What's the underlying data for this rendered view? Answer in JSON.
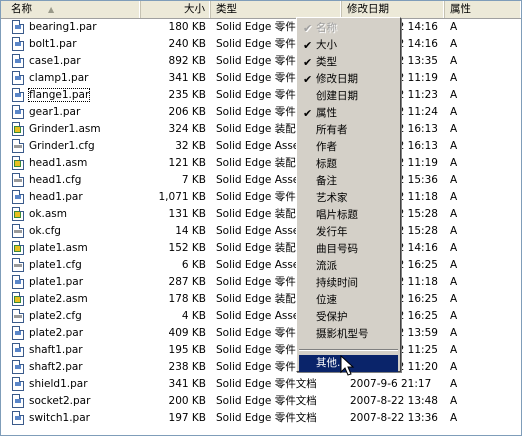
{
  "columns": {
    "name": "名称",
    "size": "大小",
    "type": "类型",
    "date": "修改日期",
    "attr": "属性"
  },
  "files": [
    {
      "name": "bearing1.par",
      "size": "180 KB",
      "type": "Solid Edge 零件文档",
      "date": "2007-8-22 14:16",
      "attr": "A",
      "icon": "par"
    },
    {
      "name": "bolt1.par",
      "size": "240 KB",
      "type": "Solid Edge 零件文档",
      "date": "2007-8-22 14:16",
      "attr": "A",
      "icon": "par"
    },
    {
      "name": "case1.par",
      "size": "892 KB",
      "type": "Solid Edge 零件文档",
      "date": "2007-8-22 13:35",
      "attr": "A",
      "icon": "par"
    },
    {
      "name": "clamp1.par",
      "size": "341 KB",
      "type": "Solid Edge 零件文档",
      "date": "2007-8-22 11:19",
      "attr": "A",
      "icon": "par"
    },
    {
      "name": "flange1.par",
      "size": "235 KB",
      "type": "Solid Edge 零件文档",
      "date": "2007-8-22 11:23",
      "attr": "A",
      "icon": "par"
    },
    {
      "name": "gear1.par",
      "size": "206 KB",
      "type": "Solid Edge 零件文档",
      "date": "2007-8-22 11:24",
      "attr": "A",
      "icon": "par"
    },
    {
      "name": "Grinder1.asm",
      "size": "324 KB",
      "type": "Solid Edge 装配文档",
      "date": "2007-8-22 16:13",
      "attr": "A",
      "icon": "asm"
    },
    {
      "name": "Grinder1.cfg",
      "size": "32 KB",
      "type": "Solid Edge Assembly",
      "date": "2007-8-22 16:13",
      "attr": "A",
      "icon": "cfg"
    },
    {
      "name": "head1.asm",
      "size": "121 KB",
      "type": "Solid Edge 装配文档",
      "date": "2007-8-22 11:19",
      "attr": "A",
      "icon": "asm"
    },
    {
      "name": "head1.cfg",
      "size": "7 KB",
      "type": "Solid Edge Assembly",
      "date": "2007-8-22 15:36",
      "attr": "A",
      "icon": "cfg"
    },
    {
      "name": "head1.par",
      "size": "1,071 KB",
      "type": "Solid Edge 零件文档",
      "date": "2007-8-22 11:18",
      "attr": "A",
      "icon": "par"
    },
    {
      "name": "ok.asm",
      "size": "131 KB",
      "type": "Solid Edge 装配文档",
      "date": "2007-8-22 15:28",
      "attr": "A",
      "icon": "asm"
    },
    {
      "name": "ok.cfg",
      "size": "14 KB",
      "type": "Solid Edge Assembly",
      "date": "2007-8-22 15:28",
      "attr": "A",
      "icon": "cfg"
    },
    {
      "name": "plate1.asm",
      "size": "152 KB",
      "type": "Solid Edge 装配文档",
      "date": "2007-8-22 14:16",
      "attr": "A",
      "icon": "asm"
    },
    {
      "name": "plate1.cfg",
      "size": "6 KB",
      "type": "Solid Edge Assembly",
      "date": "2007-8-22 16:25",
      "attr": "A",
      "icon": "cfg"
    },
    {
      "name": "plate1.par",
      "size": "287 KB",
      "type": "Solid Edge 零件文档",
      "date": "2007-8-22 11:18",
      "attr": "A",
      "icon": "par"
    },
    {
      "name": "plate2.asm",
      "size": "178 KB",
      "type": "Solid Edge 装配文档",
      "date": "2007-8-22 16:25",
      "attr": "A",
      "icon": "asm"
    },
    {
      "name": "plate2.cfg",
      "size": "4 KB",
      "type": "Solid Edge Assembly",
      "date": "2007-8-22 16:25",
      "attr": "A",
      "icon": "cfg"
    },
    {
      "name": "plate2.par",
      "size": "409 KB",
      "type": "Solid Edge 零件文档",
      "date": "2007-8-22 13:59",
      "attr": "A",
      "icon": "par"
    },
    {
      "name": "shaft1.par",
      "size": "195 KB",
      "type": "Solid Edge 零件文档",
      "date": "2007-8-22 11:25",
      "attr": "A",
      "icon": "par"
    },
    {
      "name": "shaft2.par",
      "size": "238 KB",
      "type": "Solid Edge 零件文档",
      "date": "2007-8-22 11:20",
      "attr": "A",
      "icon": "par"
    },
    {
      "name": "shield1.par",
      "size": "341 KB",
      "type": "Solid Edge 零件文档",
      "date": "2007-9-6 21:17",
      "attr": "A",
      "icon": "par"
    },
    {
      "name": "socket2.par",
      "size": "200 KB",
      "type": "Solid Edge 零件文档",
      "date": "2007-8-22 13:48",
      "attr": "A",
      "icon": "par"
    },
    {
      "name": "switch1.par",
      "size": "197 KB",
      "type": "Solid Edge 零件文档",
      "date": "2007-8-22 13:36",
      "attr": "A",
      "icon": "par"
    }
  ],
  "context_menu": [
    {
      "label": "名称",
      "checked": true,
      "disabled": true
    },
    {
      "label": "大小",
      "checked": true
    },
    {
      "label": "类型",
      "checked": true
    },
    {
      "label": "修改日期",
      "checked": true
    },
    {
      "label": "创建日期",
      "checked": false
    },
    {
      "label": "属性",
      "checked": true
    },
    {
      "label": "所有者",
      "checked": false
    },
    {
      "label": "作者",
      "checked": false
    },
    {
      "label": "标题",
      "checked": false
    },
    {
      "label": "备注",
      "checked": false
    },
    {
      "label": "艺术家",
      "checked": false
    },
    {
      "label": "唱片标题",
      "checked": false
    },
    {
      "label": "发行年",
      "checked": false
    },
    {
      "label": "曲目号码",
      "checked": false
    },
    {
      "label": "流派",
      "checked": false
    },
    {
      "label": "持续时间",
      "checked": false
    },
    {
      "label": "位速",
      "checked": false
    },
    {
      "label": "受保护",
      "checked": false
    },
    {
      "label": "摄影机型号",
      "checked": false
    }
  ],
  "context_menu_more": "其他...",
  "checkmark": "✔",
  "sort_indicator": "▲",
  "focused_file": "flange1.par",
  "highlight_color": "#0a246a"
}
